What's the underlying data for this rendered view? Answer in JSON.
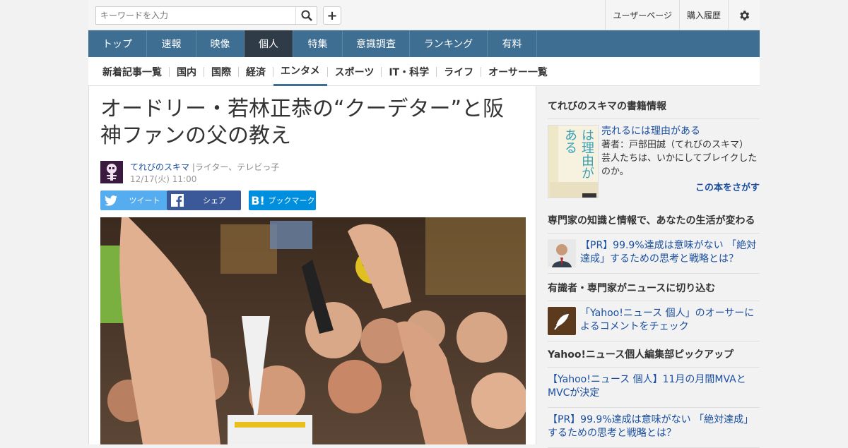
{
  "search": {
    "placeholder": "キーワードを入力"
  },
  "header_links": {
    "user_page": "ユーザーページ",
    "purchase_history": "購入履歴"
  },
  "main_nav": [
    {
      "label": "トップ",
      "active": false
    },
    {
      "label": "速報",
      "active": false
    },
    {
      "label": "映像",
      "active": false
    },
    {
      "label": "個人",
      "active": true
    },
    {
      "label": "特集",
      "active": false
    },
    {
      "label": "意識調査",
      "active": false
    },
    {
      "label": "ランキング",
      "active": false
    },
    {
      "label": "有料",
      "active": false
    }
  ],
  "sub_nav": [
    {
      "label": "新着記事一覧",
      "active": false
    },
    {
      "label": "国内",
      "active": false
    },
    {
      "label": "国際",
      "active": false
    },
    {
      "label": "経済",
      "active": false
    },
    {
      "label": "エンタメ",
      "active": true
    },
    {
      "label": "スポーツ",
      "active": false
    },
    {
      "label": "IT・科学",
      "active": false
    },
    {
      "label": "ライフ",
      "active": false
    },
    {
      "label": "オーサー一覧",
      "active": false
    }
  ],
  "article": {
    "title": "オードリー・若林正恭の“クーデター”と阪神ファンの父の教え",
    "author_name": "てれびのスキマ",
    "author_role": "|ライター、テレビっ子",
    "date": "12/17(火) 11:00",
    "share": {
      "tweet": "ツイート",
      "share": "シェア",
      "bookmark": "ブックマーク"
    }
  },
  "sidebar": {
    "book_section": {
      "heading": "てれびのスキマの書籍情報",
      "book_title": "売れるには理由がある",
      "book_cover_text": "売れるには理由がある",
      "book_author": "著者：戸部田誠（てれびのスキマ）",
      "book_desc": "芸人たちは、いかにしてブレイクしたのか。",
      "find_label": "この本をさがす"
    },
    "expert_section": {
      "heading": "専門家の知識と情報で、あなたの生活が変わる",
      "link": "【PR】99.9%達成は意味がない 「絶対達成」するための思考と戦略とは？"
    },
    "comment_section": {
      "heading": "有識者・専門家がニュースに切り込む",
      "link": "「Yahoo!ニュース 個人」のオーサーによるコメントをチェック"
    },
    "pickup_section": {
      "heading": "Yahoo!ニュース個人編集部ピックアップ",
      "links": [
        "【Yahoo!ニュース 個人】11月の月間MVAとMVCが決定",
        "【PR】99.9%達成は意味がない 「絶対達成」するための思考と戦略とは？"
      ]
    }
  },
  "colors": {
    "nav_bg": "#3e6e92",
    "nav_active": "#2f3b47",
    "link": "#1a4fa0",
    "twitter": "#55acee",
    "facebook": "#3b5998",
    "hatena": "#008fde"
  }
}
